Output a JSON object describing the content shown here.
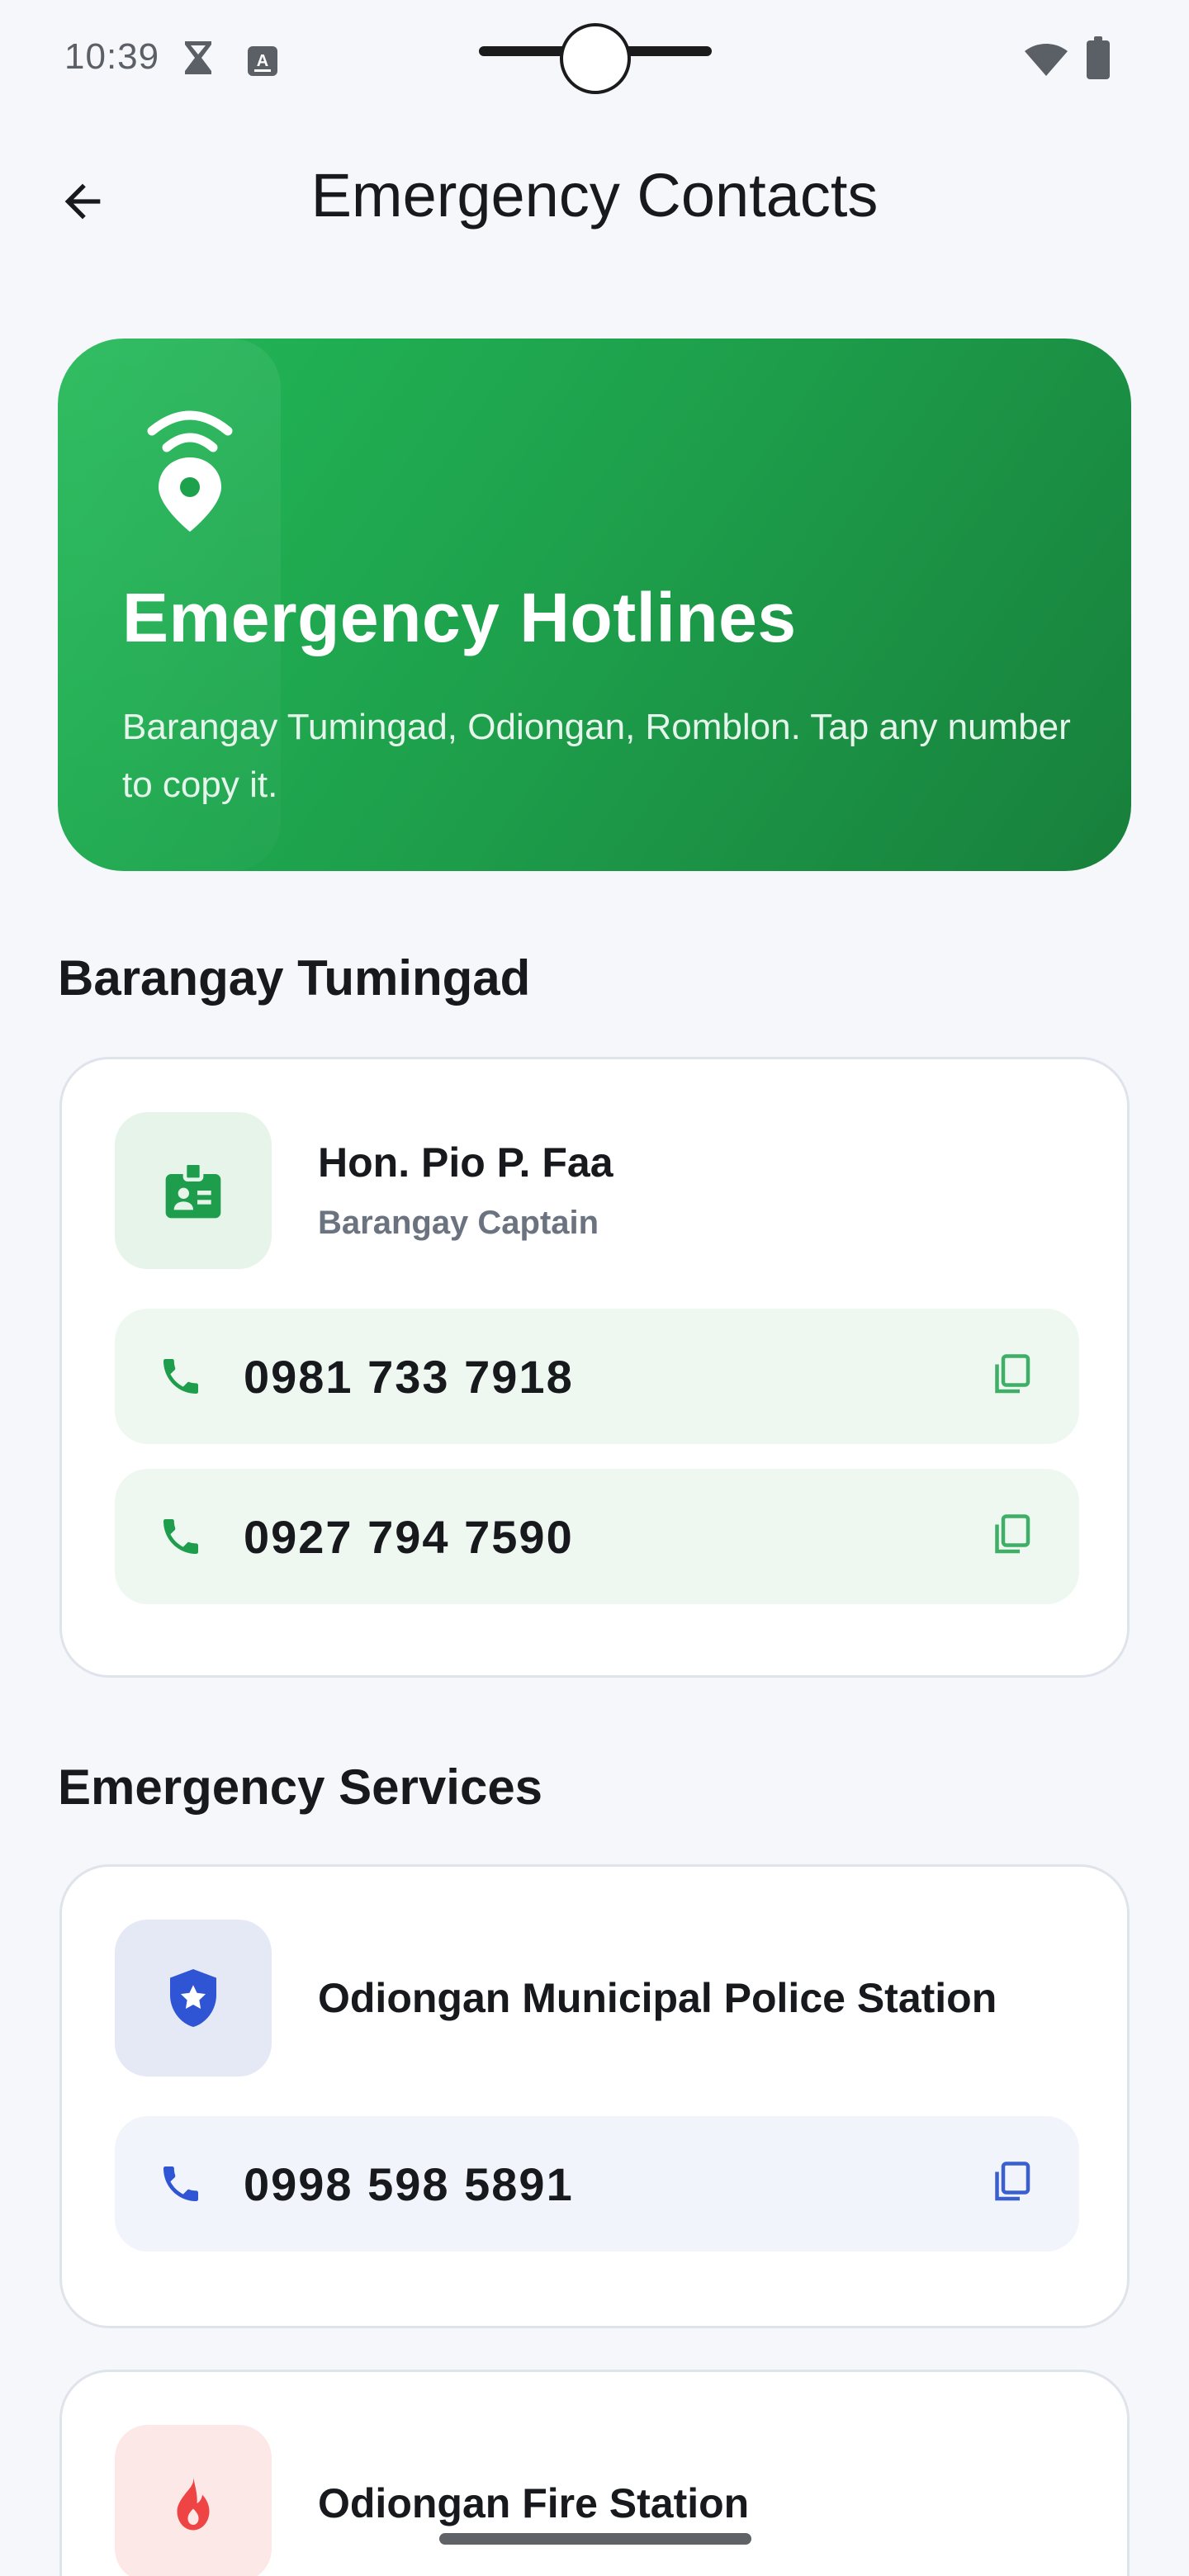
{
  "status_bar": {
    "time": "10:39"
  },
  "app_bar": {
    "title": "Emergency Contacts"
  },
  "hero": {
    "title": "Emergency Hotlines",
    "subtitle": "Barangay Tumingad, Odiongan, Romblon. Tap any number to copy it."
  },
  "sections": {
    "barangay": {
      "title": "Barangay Tumingad",
      "contact": {
        "name": "Hon. Pio P. Faa",
        "role": "Barangay Captain",
        "phones": [
          "0981 733 7918",
          "0927 794 7590"
        ]
      }
    },
    "services": {
      "title": "Emergency Services",
      "police": {
        "name": "Odiongan Municipal Police Station",
        "phone": "0998 598 5891"
      },
      "fire": {
        "name": "Odiongan Fire Station"
      }
    }
  },
  "colors": {
    "green": "#1e9e4c",
    "blue": "#2f55d4",
    "red": "#ef4444",
    "green_tint": "#eef8f1",
    "blue_tint": "#f1f4fa"
  },
  "icons": {
    "back": "arrow-left-icon",
    "hero": "wifi-location-icon",
    "captain": "badge-icon",
    "police": "shield-star-icon",
    "fire": "flame-icon",
    "phone": "phone-icon",
    "copy": "copy-icon"
  }
}
